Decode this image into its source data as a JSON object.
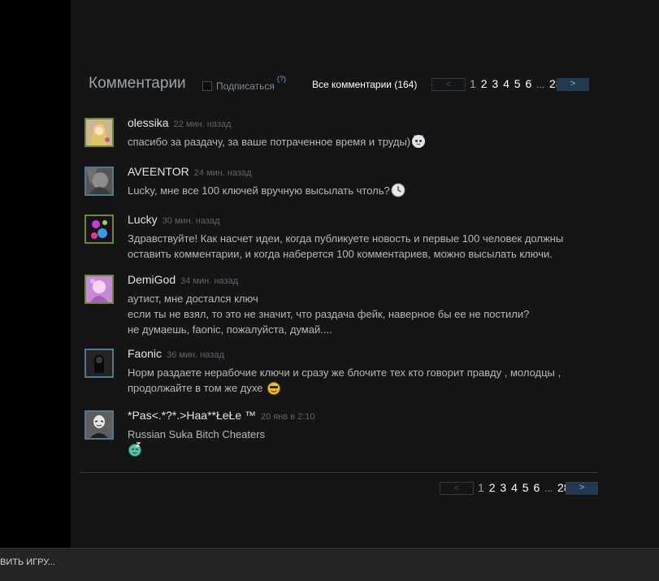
{
  "comments_section": {
    "title": "Комментарии",
    "subscribe_label": "Подписаться",
    "help_mark": "(?)",
    "all_comments_label": "Все комментарии (164)"
  },
  "pagination": {
    "prev": "<",
    "next": ">",
    "current": "1",
    "pages": [
      "2",
      "3",
      "4",
      "5",
      "6"
    ],
    "ellipsis": "...",
    "last": "28"
  },
  "comments": [
    {
      "author": "olessika",
      "time": "22 мин. назад",
      "text": "спасибо за раздачу, за ваше потраченное время и труды)",
      "emoticon": "cat-face-icon"
    },
    {
      "author": "AVEENTOR",
      "time": "24 мин. назад",
      "text": "Lucky, мне все 100 ключей вручную высылать чтоль?",
      "emoticon": "clock-icon"
    },
    {
      "author": "Lucky",
      "time": "30 мин. назад",
      "text": "Здравствуйте! Как насчет идеи, когда публикуете новость и первые 100 человек должны\nоставить комментарии, и когда наберется 100 комментариев, можно высылать ключи."
    },
    {
      "author": "DemiGod",
      "time": "34 мин. назад",
      "text": "аутист, мне достался ключ\nесли ты не взял, то это не значит, что раздача фейк, наверное бы ее не постили?\nне думаешь, faonic, пожалуйста, думай...."
    },
    {
      "author": "Faonic",
      "time": "36 мин. назад",
      "text": "Норм раздаете нерабочие ключи и сразу же блочите тех кто говорит правду , молодцы ,\nпродолжайте в том же духе ",
      "emoticon": "smiley-face-icon"
    },
    {
      "author": "*Pas<.*?*.>Haa**ŁeŁe ™",
      "time": "20 янв в 2:10",
      "text": "Russian Suka Bitch Cheaters",
      "emoticon": "sleepy-face-icon"
    }
  ],
  "bottom_bar": {
    "text": "ВИТЬ ИГРУ..."
  },
  "colors": {
    "panel_bg": "#151515",
    "page_bg": "#000000",
    "author": "#e4e4e4",
    "comment_text": "#b2b8bd",
    "timestamp": "#5a646f",
    "accent": "#67c1f5",
    "avatar_border_green": "#6a8b33",
    "avatar_border_blue": "#4c7a93"
  }
}
